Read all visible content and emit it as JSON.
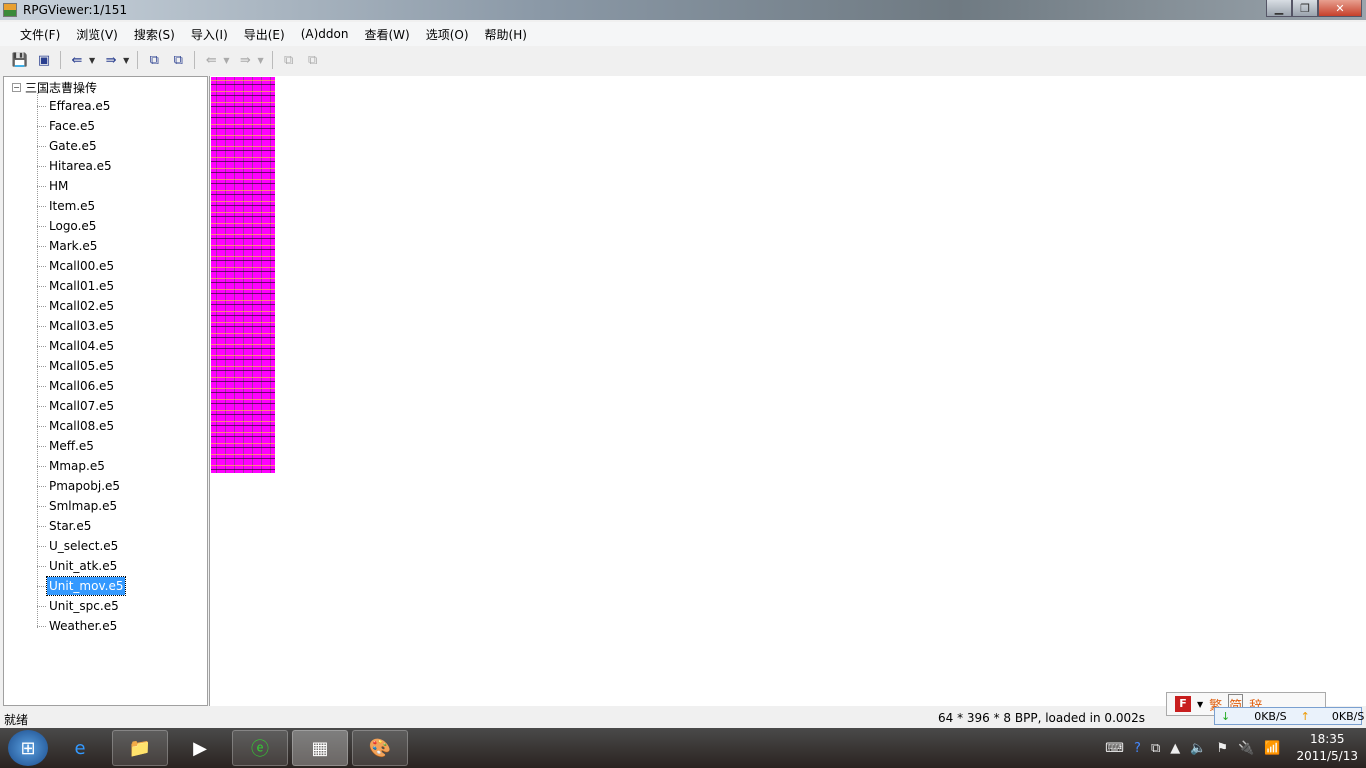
{
  "window": {
    "title": "RPGViewer:1/151"
  },
  "menu": [
    "文件(F)",
    "浏览(V)",
    "搜索(S)",
    "导入(I)",
    "导出(E)",
    "(A)ddon",
    "查看(W)",
    "选项(O)",
    "帮助(H)"
  ],
  "tree": {
    "root": "三国志曹操传",
    "items": [
      "Effarea.e5",
      "Face.e5",
      "Gate.e5",
      "Hitarea.e5",
      "HM",
      "Item.e5",
      "Logo.e5",
      "Mark.e5",
      "Mcall00.e5",
      "Mcall01.e5",
      "Mcall02.e5",
      "Mcall03.e5",
      "Mcall04.e5",
      "Mcall05.e5",
      "Mcall06.e5",
      "Mcall07.e5",
      "Mcall08.e5",
      "Meff.e5",
      "Mmap.e5",
      "Pmapobj.e5",
      "Smlmap.e5",
      "Star.e5",
      "U_select.e5",
      "Unit_atk.e5",
      "Unit_mov.e5",
      "Unit_spc.e5",
      "Weather.e5"
    ],
    "selected_index": 24
  },
  "status": {
    "left": "就绪",
    "right": "64 * 396 * 8 BPP, loaded in 0.002s"
  },
  "ime": {
    "f": "F",
    "c1": "繁",
    "c2": "简",
    "c3": "辞"
  },
  "net": {
    "down": "0KB/S",
    "up": "0KB/S"
  },
  "clock": {
    "time": "18:35",
    "date": "2011/5/13"
  },
  "colors": {
    "preview": "#ff00ff",
    "selection": "#3399ff"
  }
}
